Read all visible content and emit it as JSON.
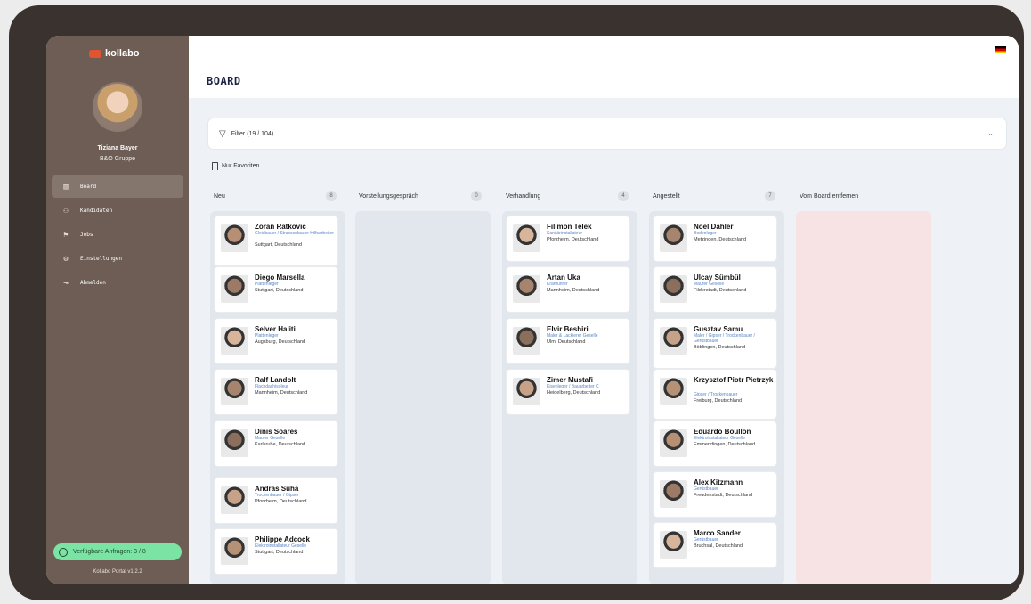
{
  "brand": {
    "logo": "kollabo"
  },
  "user": {
    "name": "Tiziana Bayer",
    "company": "B&O Gruppe"
  },
  "nav": [
    {
      "label": "Board",
      "icon": "board-icon",
      "active": true
    },
    {
      "label": "Kandidaten",
      "icon": "candidates-icon"
    },
    {
      "label": "Jobs",
      "icon": "jobs-icon"
    },
    {
      "label": "Einstellungen",
      "icon": "settings-icon"
    },
    {
      "label": "Abmelden",
      "icon": "logout-icon"
    }
  ],
  "requests": "Verfügbare Anfragen: 3 / 8",
  "version": "Kollabo Portal v1.2.2",
  "page": {
    "title": "BOARD"
  },
  "filter": {
    "label": "Filter (19 / 104)"
  },
  "favorites": {
    "label": "Nur Favoriten"
  },
  "columns": [
    {
      "title": "Neu",
      "count": "8",
      "cards": [
        {
          "name": "Zoran Ratković",
          "role": "Gleisbauer / Strassenbauer Hilfsarbeiter",
          "location": "Suttgart, Deutschland"
        },
        {
          "name": "Diego Marsella",
          "role": "Plattenleger",
          "location": "Stuttgart, Deutschland"
        },
        {
          "name": "Selver Haliti",
          "role": "Plattenleger",
          "location": "Augsburg, Deutschland"
        },
        {
          "name": "Ralf Landolt",
          "role": "Flachdachisoleur",
          "location": "Mannheim, Deutschland"
        },
        {
          "name": "Dinis Soares",
          "role": "Maurer Geselle",
          "location": "Karlsruhe, Deutschland"
        },
        {
          "name": "Andras Suha",
          "role": "Trockenbauer / Gipser",
          "location": "Pforzheim, Deutschland"
        },
        {
          "name": "Philippe Adcock",
          "role": "Elektroinstallateur Geselle",
          "location": "Stuttgart, Deutschland"
        }
      ]
    },
    {
      "title": "Vorstellungsgespräch",
      "count": "0",
      "cards": []
    },
    {
      "title": "Verhandlung",
      "count": "4",
      "cards": [
        {
          "name": "Filimon Telek",
          "role": "Sanitärinstallateur",
          "location": "Pforzheim, Deutschland"
        },
        {
          "name": "Artan Uka",
          "role": "Kranführer",
          "location": "Mannheim, Deutschland"
        },
        {
          "name": "Elvir Beshiri",
          "role": "Maler & Lackierer Geselle",
          "location": "Ulm, Deutschland"
        },
        {
          "name": "Zimer Mustafi",
          "role": "Eisenleger / Bauarbeiter C",
          "location": "Heidelberg, Deutschland"
        }
      ]
    },
    {
      "title": "Angestellt",
      "count": "7",
      "cards": [
        {
          "name": "Noel Dähler",
          "role": "Bodenleger",
          "location": "Metzingen, Deutschland"
        },
        {
          "name": "Ulcay Sümbül",
          "role": "Maurer Geselle",
          "location": "Filderstadt, Deutschland"
        },
        {
          "name": "Gusztav Samu",
          "role": "Maler / Gipser / Trockenbauer / Gerüstbauer",
          "location": "Böblingen, Deutschland"
        },
        {
          "name": "Krzysztof Piotr Pietrzyk",
          "role": "Gipser / Trockenbauer",
          "location": "Freiburg, Deutschland"
        },
        {
          "name": "Eduardo Boullon",
          "role": "Elektroinstallateur Geselle",
          "location": "Emmendingen, Deutschland"
        },
        {
          "name": "Alex Kitzmann",
          "role": "Gerüstbauer",
          "location": "Freudenstadt, Deutschland"
        },
        {
          "name": "Marco Sander",
          "role": "Gerüstbauer",
          "location": "Bruchsal, Deutschland"
        }
      ]
    },
    {
      "title": "Vom Board entfernen",
      "count": "",
      "cards": []
    }
  ],
  "colors": {
    "sidebar": "#6e5d54",
    "accent_green": "#7be3a4",
    "role_blue": "#5a85c6",
    "remove_column": "#f7e3e4"
  }
}
